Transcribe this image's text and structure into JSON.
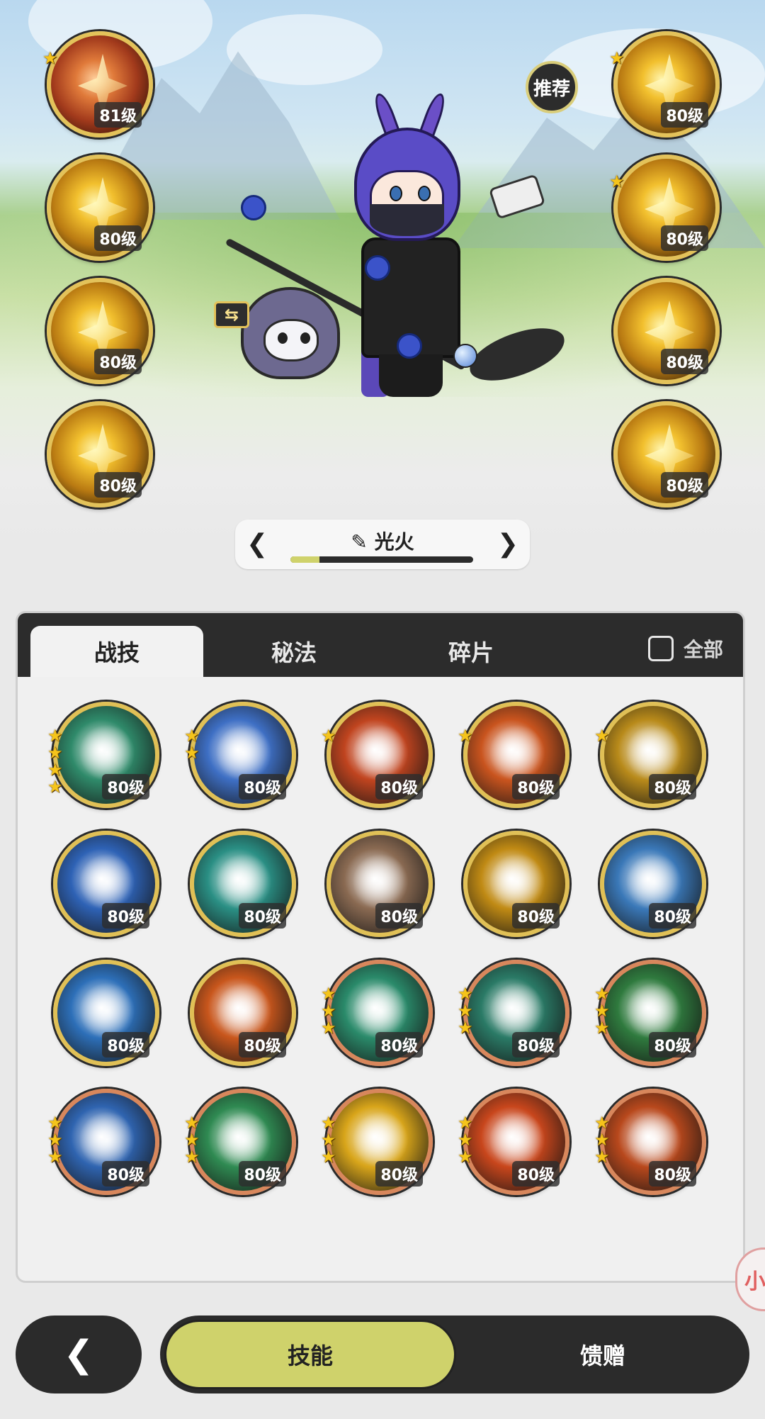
{
  "scene": {
    "recommend_label": "推荐",
    "swap_glyph": "⇆",
    "left_skills": [
      {
        "level": "81级",
        "stars": 1,
        "tone": "red"
      },
      {
        "level": "80级",
        "stars": 0,
        "tone": "gold"
      },
      {
        "level": "80级",
        "stars": 0,
        "tone": "gold"
      },
      {
        "level": "80级",
        "stars": 0,
        "tone": "gold"
      }
    ],
    "right_skills": [
      {
        "level": "80级",
        "stars": 1,
        "tone": "gold"
      },
      {
        "level": "80级",
        "stars": 1,
        "tone": "gold"
      },
      {
        "level": "80级",
        "stars": 0,
        "tone": "gold"
      },
      {
        "level": "80级",
        "stars": 0,
        "tone": "gold"
      }
    ]
  },
  "preset": {
    "prev_glyph": "❮",
    "next_glyph": "❯",
    "edit_icon": "✎",
    "name": "光火",
    "progress": 0.16
  },
  "tabs": {
    "items": [
      "战技",
      "秘法",
      "碎片"
    ],
    "active_index": 0,
    "all_label": "全部"
  },
  "grid_items": [
    {
      "level": "80级",
      "stars": 4,
      "ring": "gold",
      "color": "#2f8a6a"
    },
    {
      "level": "80级",
      "stars": 2,
      "ring": "gold",
      "color": "#3e6fc4"
    },
    {
      "level": "80级",
      "stars": 1,
      "ring": "gold",
      "color": "#c0441f"
    },
    {
      "level": "80级",
      "stars": 1,
      "ring": "gold",
      "color": "#c9541e"
    },
    {
      "level": "80级",
      "stars": 1,
      "ring": "gold",
      "color": "#b88a1a"
    },
    {
      "level": "80级",
      "stars": 0,
      "ring": "gold",
      "color": "#2e62b5"
    },
    {
      "level": "80级",
      "stars": 0,
      "ring": "gold",
      "color": "#2a8f84"
    },
    {
      "level": "80级",
      "stars": 0,
      "ring": "gold",
      "color": "#8a6a52"
    },
    {
      "level": "80级",
      "stars": 0,
      "ring": "gold",
      "color": "#c08a14"
    },
    {
      "level": "80级",
      "stars": 0,
      "ring": "gold",
      "color": "#3a78b8"
    },
    {
      "level": "80级",
      "stars": 0,
      "ring": "gold",
      "color": "#2d6fb8"
    },
    {
      "level": "80级",
      "stars": 0,
      "ring": "gold",
      "color": "#c8561c"
    },
    {
      "level": "80级",
      "stars": 3,
      "ring": "copper",
      "color": "#2a8a6a"
    },
    {
      "level": "80级",
      "stars": 3,
      "ring": "copper",
      "color": "#2a7a66"
    },
    {
      "level": "80级",
      "stars": 3,
      "ring": "copper",
      "color": "#2f7a3e"
    },
    {
      "level": "80级",
      "stars": 3,
      "ring": "copper",
      "color": "#2f64b0"
    },
    {
      "level": "80级",
      "stars": 3,
      "ring": "copper",
      "color": "#2f8a52"
    },
    {
      "level": "80级",
      "stars": 3,
      "ring": "copper",
      "color": "#d8a51a"
    },
    {
      "level": "80级",
      "stars": 3,
      "ring": "copper",
      "color": "#c8461c"
    },
    {
      "level": "80级",
      "stars": 3,
      "ring": "copper",
      "color": "#b8481c"
    }
  ],
  "bottom": {
    "back_glyph": "❮",
    "tabs": [
      "技能",
      "馈赠"
    ],
    "active_index": 0
  },
  "side_float": {
    "label": "小"
  },
  "colors": {
    "accent": "#cfd26b",
    "dark": "#2b2b2b",
    "gold_ring": "#e0c056",
    "copper_ring": "#d8875c"
  }
}
